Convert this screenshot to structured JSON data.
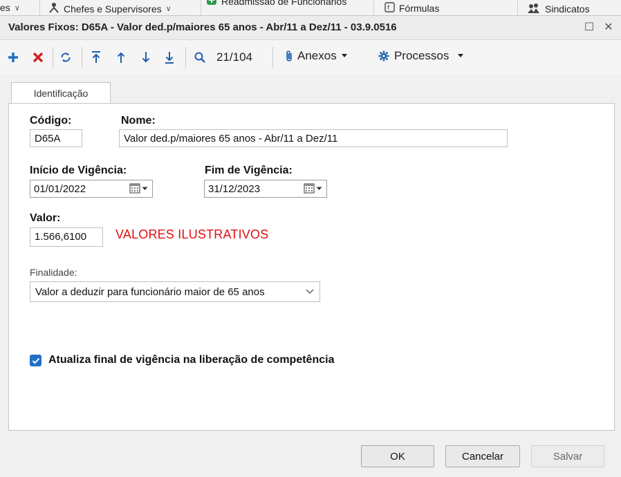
{
  "background_ribbon": {
    "items": [
      {
        "label": "es",
        "icon": "chevron-down-icon"
      },
      {
        "label": "Chefes e Supervisores",
        "icon": "people-icon"
      },
      {
        "label": "Readmissão de Funcionários",
        "icon": "add-user-icon"
      },
      {
        "label": "Fórmulas",
        "icon": "formula-icon"
      },
      {
        "label": "Sindicatos",
        "icon": "union-icon"
      }
    ]
  },
  "window": {
    "title": "Valores Fixos: D65A - Valor ded.p/maiores 65 anos - Abr/11 a Dez/11 - 03.9.0516",
    "maximize_glyph": "☐",
    "close_glyph": "✕"
  },
  "toolbar": {
    "counter": "21/104",
    "attachments_label": "Anexos",
    "processes_label": "Processos",
    "icons": [
      "add-icon",
      "delete-icon",
      "refresh-icon",
      "first-record-icon",
      "previous-record-icon",
      "next-record-icon",
      "last-record-icon",
      "search-icon",
      "paperclip-icon",
      "gear-icon"
    ]
  },
  "tabs": [
    {
      "label": "Identificação",
      "active": true
    }
  ],
  "form": {
    "codigo_label": "Código:",
    "codigo_value": "D65A",
    "nome_label": "Nome:",
    "nome_value": "Valor ded.p/maiores 65 anos - Abr/11 a Dez/11",
    "inicio_label": "Início de Vigência:",
    "inicio_value": "01/01/2022",
    "fim_label": "Fim de Vigência:",
    "fim_value": "31/12/2023",
    "valor_label": "Valor:",
    "valor_value": "1.566,6100",
    "note": "VALORES ILUSTRATIVOS",
    "finalidade_label": "Finalidade:",
    "finalidade_value": "Valor a deduzir para funcionário maior de 65 anos",
    "checkbox_label": "Atualiza final de vigência na liberação de competência",
    "checkbox_checked": true
  },
  "footer": {
    "ok_label": "OK",
    "cancel_label": "Cancelar",
    "save_label": "Salvar"
  },
  "colors": {
    "note_red": "#e01010",
    "checkbox_blue": "#1f6fc7",
    "add_green": "#1a8a3a",
    "delete_red": "#d42020",
    "nav_blue": "#1f5fb0"
  }
}
